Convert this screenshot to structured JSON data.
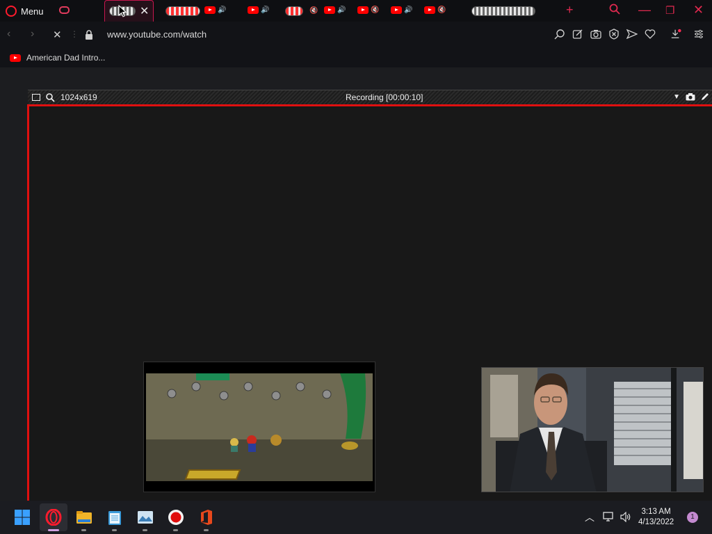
{
  "browser": {
    "menu_label": "Menu",
    "url": "www.youtube.com/watch"
  },
  "bookmarks": [
    {
      "label": "American Dad Intro..."
    }
  ],
  "recorder": {
    "dimensions": "1024x619",
    "status": "Recording [00:00:10]"
  },
  "clock": {
    "time": "3:13 AM",
    "date": "4/13/2022"
  },
  "notifications": {
    "count": "1"
  },
  "colors": {
    "accent": "#e0294f",
    "recording_border": "#e01010",
    "youtube_red": "#ff0000"
  }
}
